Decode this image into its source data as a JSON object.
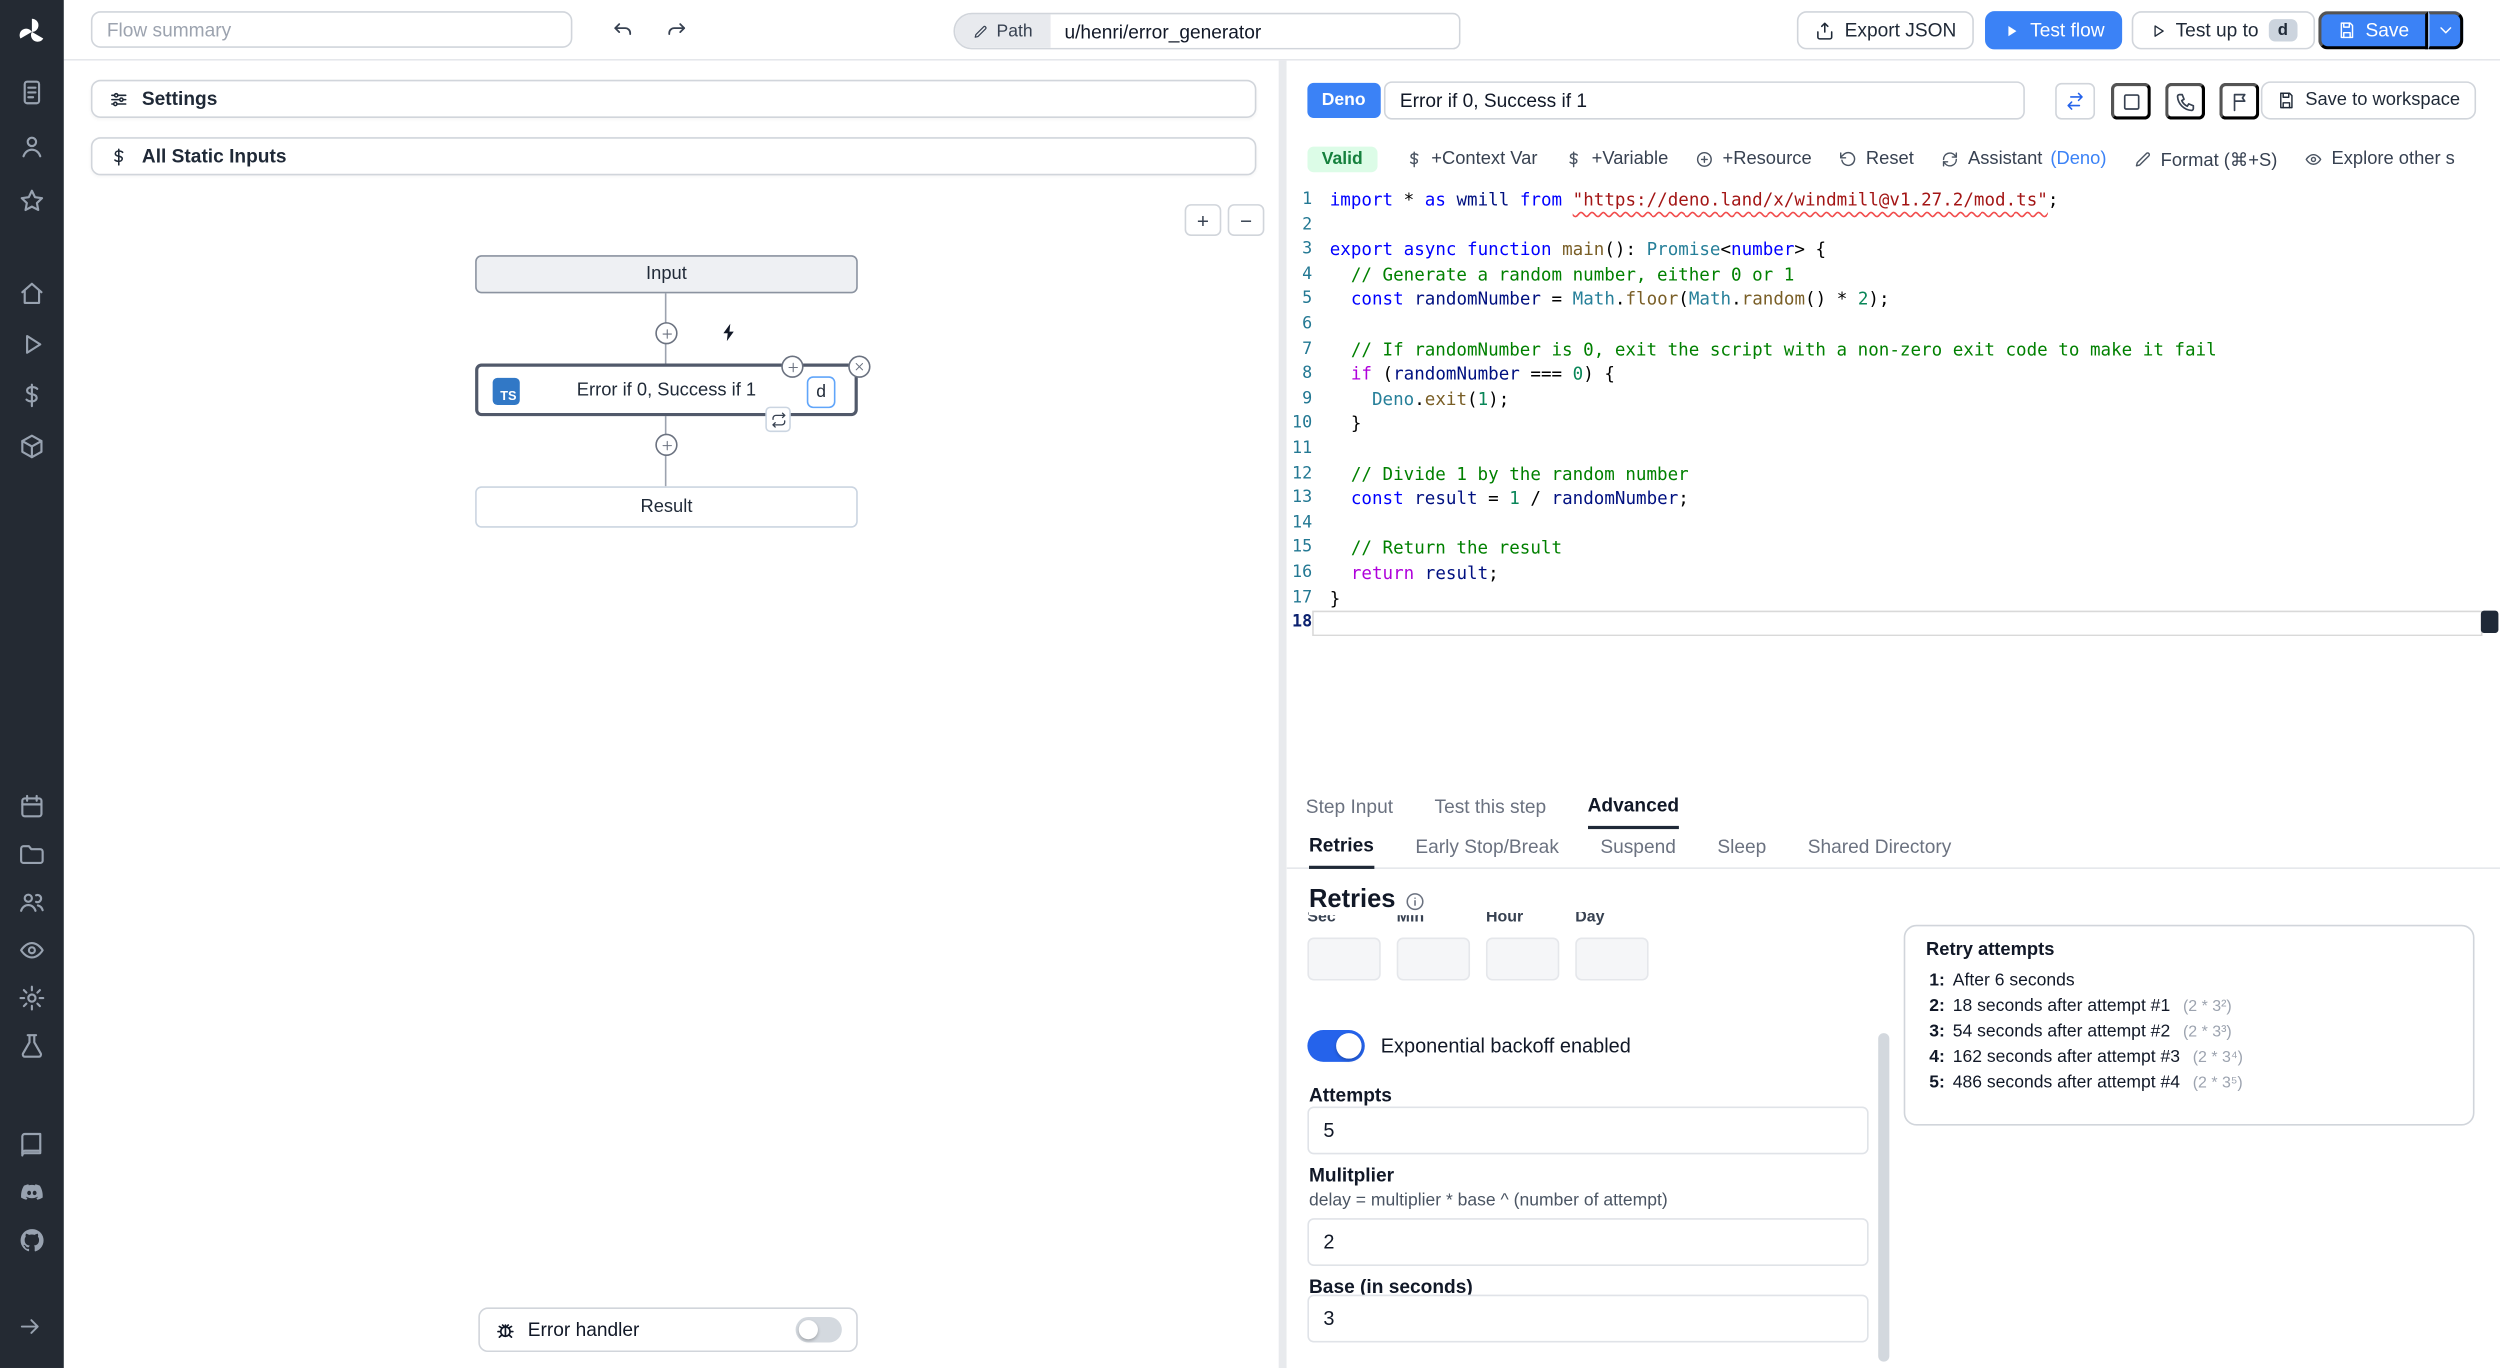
{
  "colors": {
    "accent_blue": "#3b82f6",
    "toggle_on_blue": "#2563eb",
    "valid_bg": "#dcfce7",
    "valid_text": "#15803d",
    "sidebar_bg": "#242a33",
    "ts_badge_blue": "#3178c6"
  },
  "sidebar": {
    "logo": "windmill-logo",
    "groups": [
      [
        "clipboard",
        "user",
        "star"
      ],
      [
        "home",
        "play",
        "dollar",
        "cube"
      ],
      [
        "calendar",
        "folder",
        "users",
        "eye",
        "gear",
        "flask"
      ],
      [
        "book",
        "discord",
        "github"
      ]
    ],
    "bottom": "arrow-right"
  },
  "topbar": {
    "flow_summary_placeholder": "Flow summary",
    "path_label": "Path",
    "path_value": "u/henri/error_generator",
    "export_json_label": "Export JSON",
    "test_flow_label": "Test flow",
    "test_up_to_label": "Test up to",
    "test_up_to_badge": "d",
    "save_label": "Save"
  },
  "flow": {
    "settings_label": "Settings",
    "static_inputs_label": "All Static Inputs",
    "zoom_in": "+",
    "zoom_out": "−",
    "input_node": "Input",
    "step_node": {
      "lang_badge": "TS",
      "title": "Error if 0, Success if 1",
      "suffix_badge": "d"
    },
    "result_node": "Result",
    "error_handler_label": "Error handler"
  },
  "editor": {
    "lang_badge": "Deno",
    "step_name": "Error if 0, Success if 1",
    "save_to_workspace_label": "Save to workspace",
    "toolbar": {
      "valid": "Valid",
      "context_var": "+Context Var",
      "variable": "+Variable",
      "resource": "+Resource",
      "reset": "Reset",
      "assistant": "Assistant",
      "assistant_lang": "(Deno)",
      "format": "Format (⌘+S)",
      "explore": "Explore other s"
    },
    "code": {
      "current_line": 18,
      "lines": [
        [
          [
            "kw",
            "import"
          ],
          [
            "pl",
            " * "
          ],
          [
            "kw",
            "as"
          ],
          [
            "pl",
            " "
          ],
          [
            "var",
            "wmill"
          ],
          [
            "pl",
            " "
          ],
          [
            "kw",
            "from"
          ],
          [
            "pl",
            " "
          ],
          [
            "strerr",
            "\"https://deno.land/x/windmill@v1.27.2/mod.ts\""
          ],
          [
            "pl",
            ";"
          ]
        ],
        [],
        [
          [
            "kw",
            "export"
          ],
          [
            "pl",
            " "
          ],
          [
            "kw",
            "async"
          ],
          [
            "pl",
            " "
          ],
          [
            "kw",
            "function"
          ],
          [
            "pl",
            " "
          ],
          [
            "fn",
            "main"
          ],
          [
            "pl",
            "(): "
          ],
          [
            "type",
            "Promise"
          ],
          [
            "pl",
            "<"
          ],
          [
            "kw",
            "number"
          ],
          [
            "pl",
            "> {"
          ]
        ],
        [
          [
            "com",
            "  // Generate a random number, either 0 or 1"
          ]
        ],
        [
          [
            "pl",
            "  "
          ],
          [
            "kw",
            "const"
          ],
          [
            "pl",
            " "
          ],
          [
            "var",
            "randomNumber"
          ],
          [
            "pl",
            " = "
          ],
          [
            "type",
            "Math"
          ],
          [
            "pl",
            "."
          ],
          [
            "fn",
            "floor"
          ],
          [
            "pl",
            "("
          ],
          [
            "type",
            "Math"
          ],
          [
            "pl",
            "."
          ],
          [
            "fn",
            "random"
          ],
          [
            "pl",
            "() * "
          ],
          [
            "num",
            "2"
          ],
          [
            "pl",
            ");"
          ]
        ],
        [],
        [
          [
            "com",
            "  // If randomNumber is 0, exit the script with a non-zero exit code to make it fail"
          ]
        ],
        [
          [
            "pl",
            "  "
          ],
          [
            "ctrl",
            "if"
          ],
          [
            "pl",
            " ("
          ],
          [
            "var",
            "randomNumber"
          ],
          [
            "pl",
            " === "
          ],
          [
            "num",
            "0"
          ],
          [
            "pl",
            ") {"
          ]
        ],
        [
          [
            "pl",
            "    "
          ],
          [
            "type",
            "Deno"
          ],
          [
            "pl",
            "."
          ],
          [
            "fn",
            "exit"
          ],
          [
            "pl",
            "("
          ],
          [
            "num",
            "1"
          ],
          [
            "pl",
            ");"
          ]
        ],
        [
          [
            "pl",
            "  }"
          ]
        ],
        [],
        [
          [
            "com",
            "  // Divide 1 by the random number"
          ]
        ],
        [
          [
            "pl",
            "  "
          ],
          [
            "kw",
            "const"
          ],
          [
            "pl",
            " "
          ],
          [
            "var",
            "result"
          ],
          [
            "pl",
            " = "
          ],
          [
            "num",
            "1"
          ],
          [
            "pl",
            " / "
          ],
          [
            "var",
            "randomNumber"
          ],
          [
            "pl",
            ";"
          ]
        ],
        [],
        [
          [
            "com",
            "  // Return the result"
          ]
        ],
        [
          [
            "pl",
            "  "
          ],
          [
            "ctrl",
            "return"
          ],
          [
            "pl",
            " "
          ],
          [
            "var",
            "result"
          ],
          [
            "pl",
            ";"
          ]
        ],
        [
          [
            "pl",
            "}"
          ]
        ],
        []
      ]
    }
  },
  "panel_tabs": [
    {
      "label": "Step Input",
      "active": false
    },
    {
      "label": "Test this step",
      "active": false
    },
    {
      "label": "Advanced",
      "active": true
    }
  ],
  "advanced_tabs": [
    {
      "label": "Retries",
      "active": true
    },
    {
      "label": "Early Stop/Break",
      "active": false
    },
    {
      "label": "Suspend",
      "active": false
    },
    {
      "label": "Sleep",
      "active": false
    },
    {
      "label": "Shared Directory",
      "active": false
    }
  ],
  "retries": {
    "heading": "Retries",
    "cron_fields": [
      {
        "label": "Sec",
        "value": ""
      },
      {
        "label": "Min",
        "value": ""
      },
      {
        "label": "Hour",
        "value": ""
      },
      {
        "label": "Day",
        "value": ""
      }
    ],
    "toggle_label": "Exponential backoff enabled",
    "toggle_on": true,
    "attempts_label": "Attempts",
    "attempts_value": "5",
    "multiplier_label": "Mulitplier",
    "multiplier_help": "delay = multiplier * base ^ (number of attempt)",
    "multiplier_value": "2",
    "base_label": "Base (in seconds)",
    "base_value": "3",
    "retry_attempts": {
      "title": "Retry attempts",
      "rows": [
        {
          "n": "1:",
          "text": "After 6 seconds",
          "formula": ""
        },
        {
          "n": "2:",
          "text": "18 seconds after attempt #1",
          "formula": "(2 * 3²)"
        },
        {
          "n": "3:",
          "text": "54 seconds after attempt #2",
          "formula": "(2 * 3³)"
        },
        {
          "n": "4:",
          "text": "162 seconds after attempt #3",
          "formula": "(2 * 3⁴)"
        },
        {
          "n": "5:",
          "text": "486 seconds after attempt #4",
          "formula": "(2 * 3⁵)"
        }
      ]
    }
  }
}
